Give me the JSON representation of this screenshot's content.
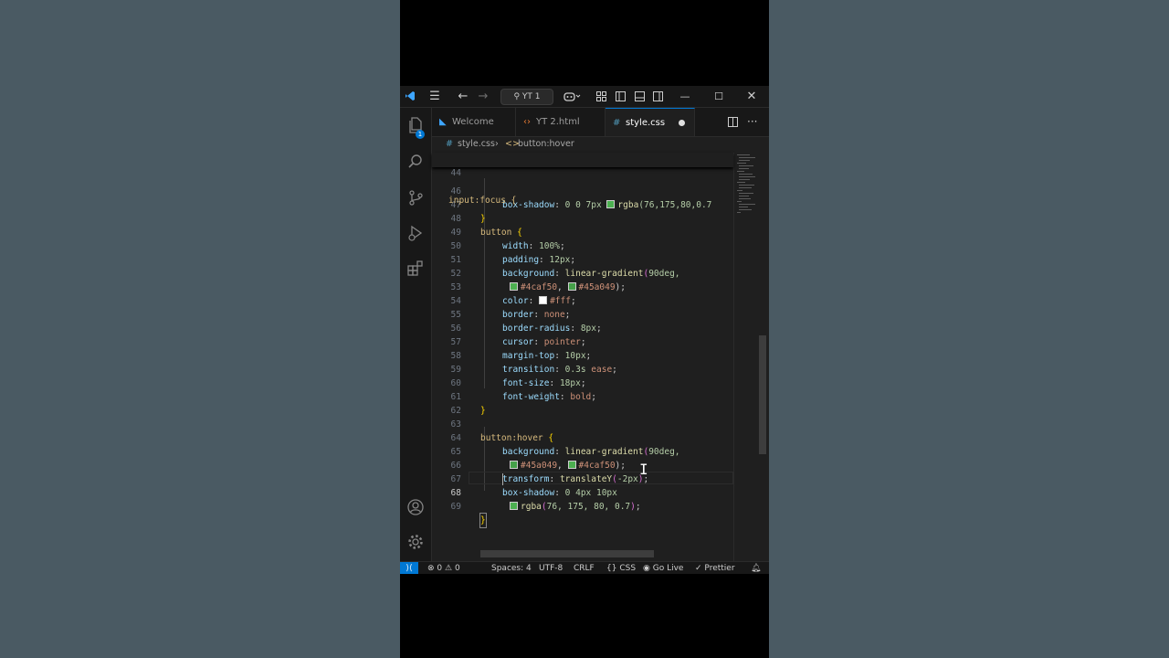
{
  "titlebar": {
    "search_label": "YT 1"
  },
  "activity": {
    "explorer_badge": "1"
  },
  "tabs": [
    {
      "label": "Welcome",
      "icon": "vscode-icon"
    },
    {
      "label": "YT 2.html",
      "icon": "html-icon"
    },
    {
      "label": "style.css",
      "icon": "css-icon",
      "active": true,
      "modified": true
    }
  ],
  "breadcrumb": {
    "file": "style.css",
    "symbol": "button:hover",
    "hash": "#"
  },
  "editor": {
    "sticky": {
      "line": "44",
      "text": "input:focus {"
    },
    "lines": [
      {
        "n": "46"
      },
      {
        "n": "47"
      },
      {
        "n": "48"
      },
      {
        "n": "49"
      },
      {
        "n": "50"
      },
      {
        "n": "51"
      },
      {
        "n": "52"
      },
      {
        "n": "53"
      },
      {
        "n": "54"
      },
      {
        "n": "55"
      },
      {
        "n": "56"
      },
      {
        "n": "57"
      },
      {
        "n": "58"
      },
      {
        "n": "59"
      },
      {
        "n": "60"
      },
      {
        "n": "61"
      },
      {
        "n": "62"
      },
      {
        "n": "63"
      },
      {
        "n": "64"
      },
      {
        "n": "65"
      },
      {
        "n": "66"
      },
      {
        "n": "67"
      },
      {
        "n": "68"
      },
      {
        "n": "69"
      }
    ],
    "t": {
      "l46_prop": "box-shadow",
      "l46_val": " 0 0 7px ",
      "l46_fn": "rgba",
      "l46_args": "(76,175,80,0.7",
      "l47": "}",
      "l48_sel": "button",
      "l48_b": "{",
      "l49_prop": "width",
      "l49_val": "100%",
      "l50_prop": "padding",
      "l50_val": "12px",
      "l51_prop": "background",
      "l51_fn": "linear-gradient",
      "l51_args": "90deg,",
      "l52_c1": "#4caf50",
      "l52_c2": "#45a049",
      "l52_end": ");",
      "l53_prop": "color",
      "l53_val": "#fff",
      "l54_prop": "border",
      "l54_val": "none",
      "l55_prop": "border-radius",
      "l55_val": "8px",
      "l56_prop": "cursor",
      "l56_val": "pointer",
      "l57_prop": "margin-top",
      "l57_val": "10px",
      "l58_prop": "transition",
      "l58_num": "0.3s",
      "l58_val": "ease",
      "l59_prop": "font-size",
      "l59_val": "18px",
      "l60_prop": "font-weight",
      "l60_val": "bold",
      "l61": "}",
      "l63_sel": "button:hover",
      "l63_b": "{",
      "l64_prop": "background",
      "l64_fn": "linear-gradient",
      "l64_args": "90deg,",
      "l65_c1": "#45a049",
      "l65_c2": "#4caf50",
      "l65_end": ");",
      "l66_prop": "transform",
      "l66_fn": "translateY",
      "l66_args": "-2px",
      "l67_prop": "box-shadow",
      "l67_val": "0 4px 10px",
      "l68_fn": "rgba",
      "l68_args": "76, 175, 80, 0.7",
      "l69": "}"
    },
    "colors": {
      "green": "#4caf50",
      "green_dark": "#45a049",
      "white": "#ffffff"
    }
  },
  "status": {
    "errors": "0",
    "warnings": "0",
    "spaces": "Spaces: 4",
    "encoding": "UTF-8",
    "eol": "CRLF",
    "language": "CSS",
    "golive": "Go Live",
    "prettier": "Prettier"
  }
}
